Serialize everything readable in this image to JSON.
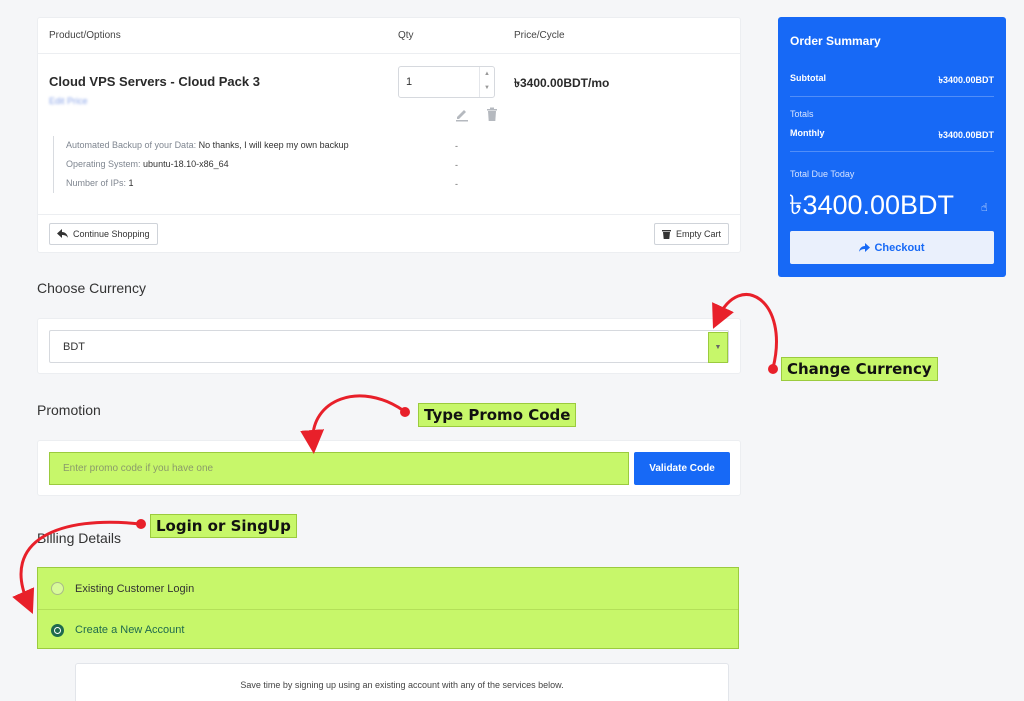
{
  "cart": {
    "headers": {
      "product": "Product/Options",
      "qty": "Qty",
      "price": "Price/Cycle"
    },
    "item": {
      "name": "Cloud VPS Servers - Cloud Pack 3",
      "subtitle": "Edit Price",
      "qty": "1",
      "price": "৳3400.00BDT/mo",
      "options": [
        {
          "label": "Automated Backup of your Data:",
          "value": "No thanks, I will keep my own backup",
          "qty": "-"
        },
        {
          "label": "Operating System:",
          "value": "ubuntu-18.10-x86_64",
          "qty": "-"
        },
        {
          "label": "Number of IPs:",
          "value": "1",
          "qty": "-"
        }
      ]
    },
    "continue_label": "Continue Shopping",
    "empty_label": "Empty Cart"
  },
  "summary": {
    "title": "Order Summary",
    "subtotal_label": "Subtotal",
    "subtotal_value": "৳3400.00BDT",
    "totals_label": "Totals",
    "monthly_label": "Monthly",
    "monthly_value": "৳3400.00BDT",
    "due_label": "Total Due Today",
    "due_value": "৳3400.00BDT",
    "checkout_label": "Checkout"
  },
  "currency": {
    "title": "Choose Currency",
    "selected": "BDT"
  },
  "promotion": {
    "title": "Promotion",
    "placeholder": "Enter promo code if you have one",
    "validate_label": "Validate Code"
  },
  "billing": {
    "title": "Billing Details",
    "existing_label": "Existing Customer Login",
    "new_label": "Create a New Account",
    "social_text": "Save time by signing up using an existing account with any of the services below."
  },
  "callouts": {
    "change_currency": "Change Currency",
    "promo": "Type Promo Code",
    "login": "Login or SingUp"
  },
  "colors": {
    "accent": "#1769f6",
    "highlight": "#c7f76a",
    "arrow": "#e8202a"
  }
}
